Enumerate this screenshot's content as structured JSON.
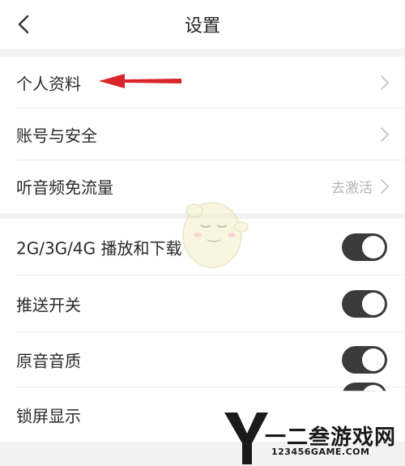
{
  "header": {
    "title": "设置",
    "back_icon": "chevron-left-icon"
  },
  "account_group": {
    "items": [
      {
        "label": "个人资料",
        "right_text": "",
        "icon": "chevron-right-icon"
      },
      {
        "label": "账号与安全",
        "right_text": "",
        "icon": "chevron-right-icon"
      },
      {
        "label": "听音频免流量",
        "right_text": "去激活",
        "icon": "chevron-right-icon"
      }
    ]
  },
  "settings_group": {
    "items": [
      {
        "label": "2G/3G/4G 播放和下载",
        "toggle_on": true
      },
      {
        "label": "推送开关",
        "toggle_on": true
      },
      {
        "label": "原音音质",
        "toggle_on": true
      },
      {
        "label": "锁屏显示",
        "toggle_on": true
      }
    ]
  },
  "annotation": {
    "arrow_color": "#d8262b"
  },
  "colors": {
    "toggle_on": "#3b3b3b",
    "page_bg": "#f2f2f2",
    "row_bg": "#ffffff"
  },
  "watermark": {
    "main": "一二叁游戏网",
    "sub": "123456GAME.COM"
  }
}
